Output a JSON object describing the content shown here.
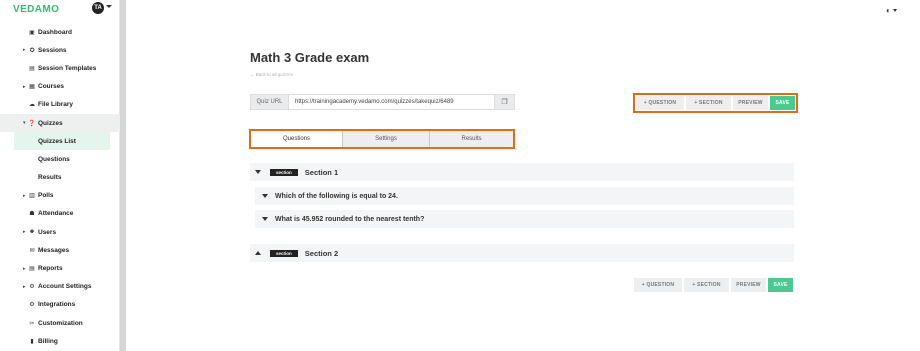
{
  "brand": {
    "name": "VEDAMO",
    "avatar_initials": "TA"
  },
  "sidebar": {
    "items": [
      {
        "label": "Dashboard",
        "icon": "dashboard-icon",
        "arrow": ""
      },
      {
        "label": "Sessions",
        "icon": "sessions-icon",
        "arrow": "▸"
      },
      {
        "label": "Session Templates",
        "icon": "templates-icon",
        "arrow": ""
      },
      {
        "label": "Courses",
        "icon": "courses-icon",
        "arrow": "▸"
      },
      {
        "label": "File Library",
        "icon": "cloud-icon",
        "arrow": ""
      },
      {
        "label": "Quizzes",
        "icon": "quiz-icon",
        "arrow": "▾"
      },
      {
        "label": "Quizzes List",
        "icon": "",
        "arrow": ""
      },
      {
        "label": "Questions",
        "icon": "",
        "arrow": ""
      },
      {
        "label": "Results",
        "icon": "",
        "arrow": ""
      },
      {
        "label": "Polls",
        "icon": "polls-icon",
        "arrow": "▸"
      },
      {
        "label": "Attendance",
        "icon": "attendance-icon",
        "arrow": ""
      },
      {
        "label": "Users",
        "icon": "users-icon",
        "arrow": "▸"
      },
      {
        "label": "Messages",
        "icon": "messages-icon",
        "arrow": ""
      },
      {
        "label": "Reports",
        "icon": "reports-icon",
        "arrow": "▸"
      },
      {
        "label": "Account Settings",
        "icon": "settings-icon",
        "arrow": "▸"
      },
      {
        "label": "Integrations",
        "icon": "integrations-icon",
        "arrow": ""
      },
      {
        "label": "Customization",
        "icon": "customization-icon",
        "arrow": ""
      },
      {
        "label": "Billing",
        "icon": "billing-icon",
        "arrow": ""
      }
    ]
  },
  "main": {
    "title": "Math 3 Grade exam",
    "back_link": "← Back to all quizzes",
    "url_label": "Quiz URL",
    "url_value": "https://trainingacademy.vedamo.com/quizzes/takequiz/6489",
    "toolbar": {
      "question": "+ QUESTION",
      "section": "+ SECTION",
      "preview": "PREVIEW",
      "save": "SAVE"
    },
    "tabs": [
      "Questions",
      "Settings",
      "Results"
    ],
    "section_badge": "section",
    "section1": "Section 1",
    "questions": [
      "Which of the following is equal to 24.",
      "What is 45.952 rounded to the nearest tenth?"
    ],
    "section2": "Section 2"
  },
  "colors": {
    "accent_green": "#4cc990",
    "brand_green": "#2fbf71",
    "highlight_orange": "#e16b1b"
  }
}
